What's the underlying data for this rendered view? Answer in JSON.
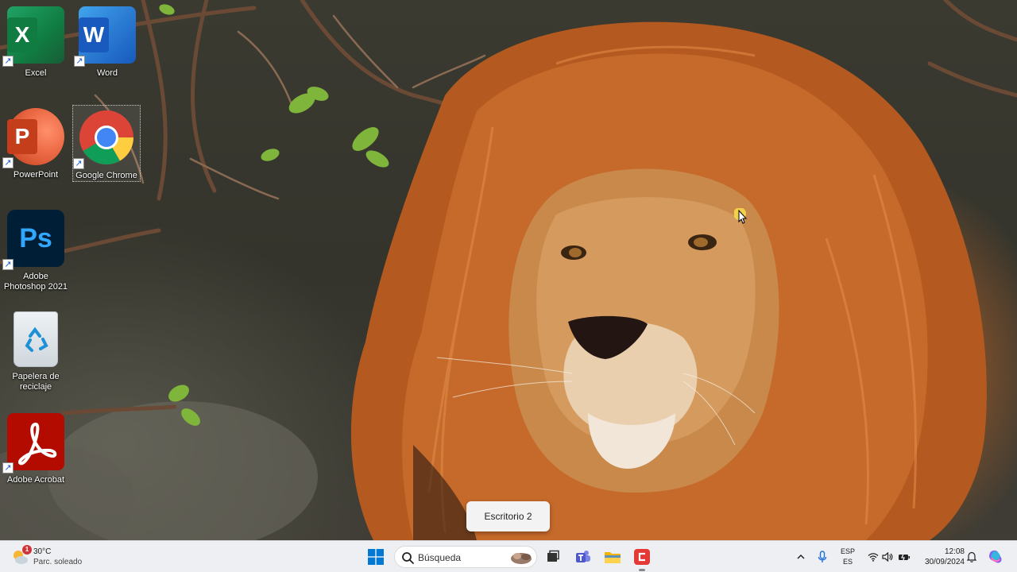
{
  "desktop": {
    "icons": [
      {
        "label": "Excel",
        "letter": "X"
      },
      {
        "label": "Word",
        "letter": "W"
      },
      {
        "label": "PowerPoint",
        "letter": "P"
      },
      {
        "label": "Google Chrome"
      },
      {
        "label": "Adobe Photoshop 2021",
        "letter": "Ps"
      },
      {
        "label": "Papelera de reciclaje"
      },
      {
        "label": "Adobe Acrobat"
      }
    ],
    "shortcut_glyph": "↗"
  },
  "tooltip": {
    "text": "Escritorio 2"
  },
  "taskbar": {
    "weather": {
      "temp": "30°C",
      "desc": "Parc. soleado",
      "badge": "1"
    },
    "search": {
      "placeholder": "Búsqueda"
    },
    "tray": {
      "lang_line1": "ESP",
      "lang_line2": "ES",
      "time": "12:08",
      "date": "30/09/2024"
    }
  },
  "colors": {
    "taskbar_bg": "#eeeff2",
    "windows_blue": "#0078d4",
    "excel_green": "#107c41",
    "word_blue": "#185abd",
    "ppt_orange": "#c43e1c",
    "photoshop_blue": "#31a8ff",
    "acrobat_red": "#b30b00"
  }
}
